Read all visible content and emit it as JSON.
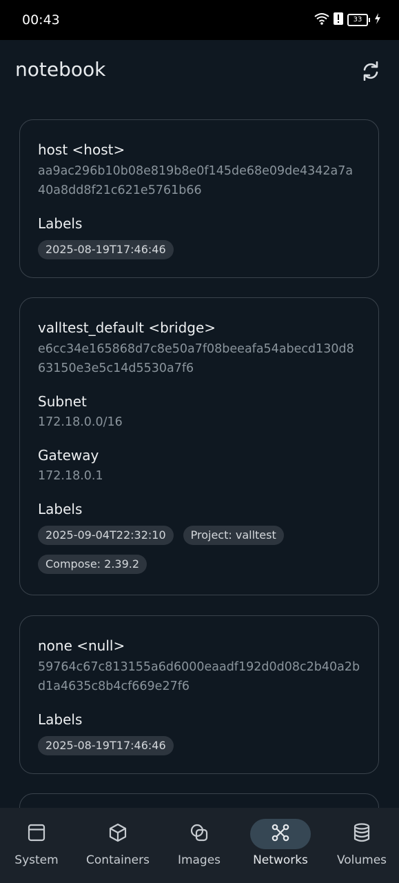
{
  "status": {
    "time": "00:43",
    "battery": "33"
  },
  "appbar": {
    "title": "notebook"
  },
  "networks": [
    {
      "title": "host <host>",
      "id": "aa9ac296b10b08e819b8e0f145de68e09de4342a7a40a8dd8f21c621e5761b66",
      "labels_heading": "Labels",
      "labels": [
        "2025-08-19T17:46:46"
      ]
    },
    {
      "title": "valltest_default <bridge>",
      "id": "e6cc34e165868d7c8e50a7f08beeafa54abecd130d863150e3e5c14d5530a7f6",
      "subnet_heading": "Subnet",
      "subnet": "172.18.0.0/16",
      "gateway_heading": "Gateway",
      "gateway": "172.18.0.1",
      "labels_heading": "Labels",
      "labels": [
        "2025-09-04T22:32:10",
        "Project: valltest",
        "Compose: 2.39.2"
      ]
    },
    {
      "title": "none <null>",
      "id": "59764c67c813155a6d6000eaadf192d0d08c2b40a2bd1a4635c8b4cf669e27f6",
      "labels_heading": "Labels",
      "labels": [
        "2025-08-19T17:46:46"
      ]
    }
  ],
  "nav": {
    "items": [
      {
        "label": "System",
        "icon": "window-icon"
      },
      {
        "label": "Containers",
        "icon": "cube-icon"
      },
      {
        "label": "Images",
        "icon": "layers-icon"
      },
      {
        "label": "Networks",
        "icon": "network-icon",
        "active": true
      },
      {
        "label": "Volumes",
        "icon": "database-icon"
      }
    ]
  },
  "colors": {
    "background": "#0f1821",
    "card_border": "#3a434c",
    "chip": "#2d353e",
    "nav_active": "#364754"
  }
}
